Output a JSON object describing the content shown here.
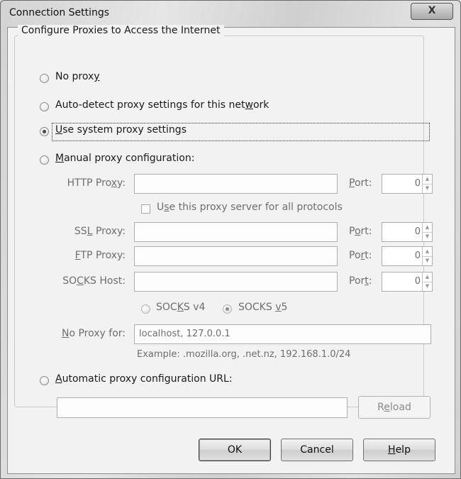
{
  "window": {
    "title": "Connection Settings",
    "close_glyph": "X"
  },
  "group": {
    "legend": "Configure Proxies to Access the Internet"
  },
  "options": {
    "no_proxy": {
      "pre": "No prox",
      "key": "y",
      "post": "",
      "checked": false
    },
    "auto_detect": {
      "pre": "Auto-detect proxy settings for this net",
      "key": "w",
      "post": "ork",
      "checked": false
    },
    "system": {
      "pre": "",
      "key": "U",
      "post": "se system proxy settings",
      "checked": true
    },
    "manual": {
      "pre": "",
      "key": "M",
      "post": "anual proxy configuration:",
      "checked": false
    },
    "auto_url": {
      "pre": "",
      "key": "A",
      "post": "utomatic proxy configuration URL:",
      "checked": false
    }
  },
  "http": {
    "pre": "HTTP Pro",
    "key": "x",
    "post": "y:",
    "value": "",
    "port_pre": "",
    "port_key": "P",
    "port_post": "ort:",
    "port": "0"
  },
  "use_all": {
    "pre": "U",
    "key": "s",
    "post": "e this proxy server for all protocols",
    "checked": false
  },
  "ssl": {
    "pre": "SS",
    "key": "L",
    "post": " Proxy:",
    "value": "",
    "port_pre": "P",
    "port_key": "o",
    "port_post": "rt:",
    "port": "0"
  },
  "ftp": {
    "pre": "",
    "key": "F",
    "post": "TP Proxy:",
    "value": "",
    "port_pre": "Po",
    "port_key": "r",
    "port_post": "t:",
    "port": "0"
  },
  "socks": {
    "pre": "SO",
    "key": "C",
    "post": "KS Host:",
    "value": "",
    "port_pre": "Por",
    "port_key": "t",
    "port_post": ":",
    "port": "0"
  },
  "socks_version": {
    "v4": {
      "pre": "SOC",
      "key": "K",
      "post": "S v4",
      "checked": false
    },
    "v5": {
      "pre": "SOCKS ",
      "key": "v",
      "post": "5",
      "checked": true
    }
  },
  "no_proxy_for": {
    "pre": "",
    "key": "N",
    "post": "o Proxy for:",
    "value": "localhost, 127.0.0.1",
    "example": "Example: .mozilla.org, .net.nz, 192.168.1.0/24"
  },
  "auto_url_field": {
    "value": ""
  },
  "reload": {
    "pre": "R",
    "key": "e",
    "post": "load"
  },
  "buttons": {
    "ok": "OK",
    "cancel": "Cancel",
    "help": {
      "pre": "",
      "key": "H",
      "post": "elp"
    }
  },
  "icons": {
    "radio": "radio-icon",
    "checkbox": "checkbox-icon",
    "spin_up": "▲",
    "spin_down": "▼"
  }
}
